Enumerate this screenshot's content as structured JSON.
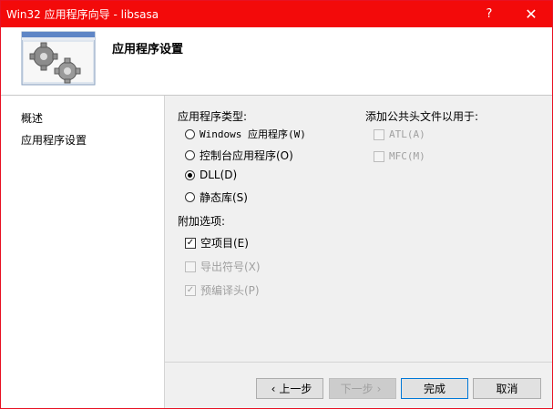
{
  "window": {
    "title": "Win32 应用程序向导 - libsasa",
    "help_glyph": "?",
    "close_glyph": "✕"
  },
  "header": {
    "title": "应用程序设置"
  },
  "sidebar": {
    "items": [
      {
        "label": "概述"
      },
      {
        "label": "应用程序设置"
      }
    ]
  },
  "app_type": {
    "label": "应用程序类型:",
    "options": [
      {
        "label": "Windows 应用程序(W)",
        "checked": false
      },
      {
        "label": "控制台应用程序(O)",
        "checked": false
      },
      {
        "label": "DLL(D)",
        "checked": true
      },
      {
        "label": "静态库(S)",
        "checked": false
      }
    ]
  },
  "extra": {
    "label": "附加选项:",
    "options": [
      {
        "label": "空项目(E)",
        "checked": true,
        "enabled": true
      },
      {
        "label": "导出符号(X)",
        "checked": false,
        "enabled": false
      },
      {
        "label": "预编译头(P)",
        "checked": true,
        "enabled": false
      }
    ]
  },
  "common_headers": {
    "label": "添加公共头文件以用于:",
    "options": [
      {
        "label": "ATL(A)",
        "checked": false,
        "enabled": false
      },
      {
        "label": "MFC(M)",
        "checked": false,
        "enabled": false
      }
    ]
  },
  "buttons": {
    "prev": "上一步",
    "next": "下一步",
    "finish": "完成",
    "cancel": "取消"
  },
  "colors": {
    "titlebar": "#f30a0a",
    "accent": "#0078d7"
  }
}
